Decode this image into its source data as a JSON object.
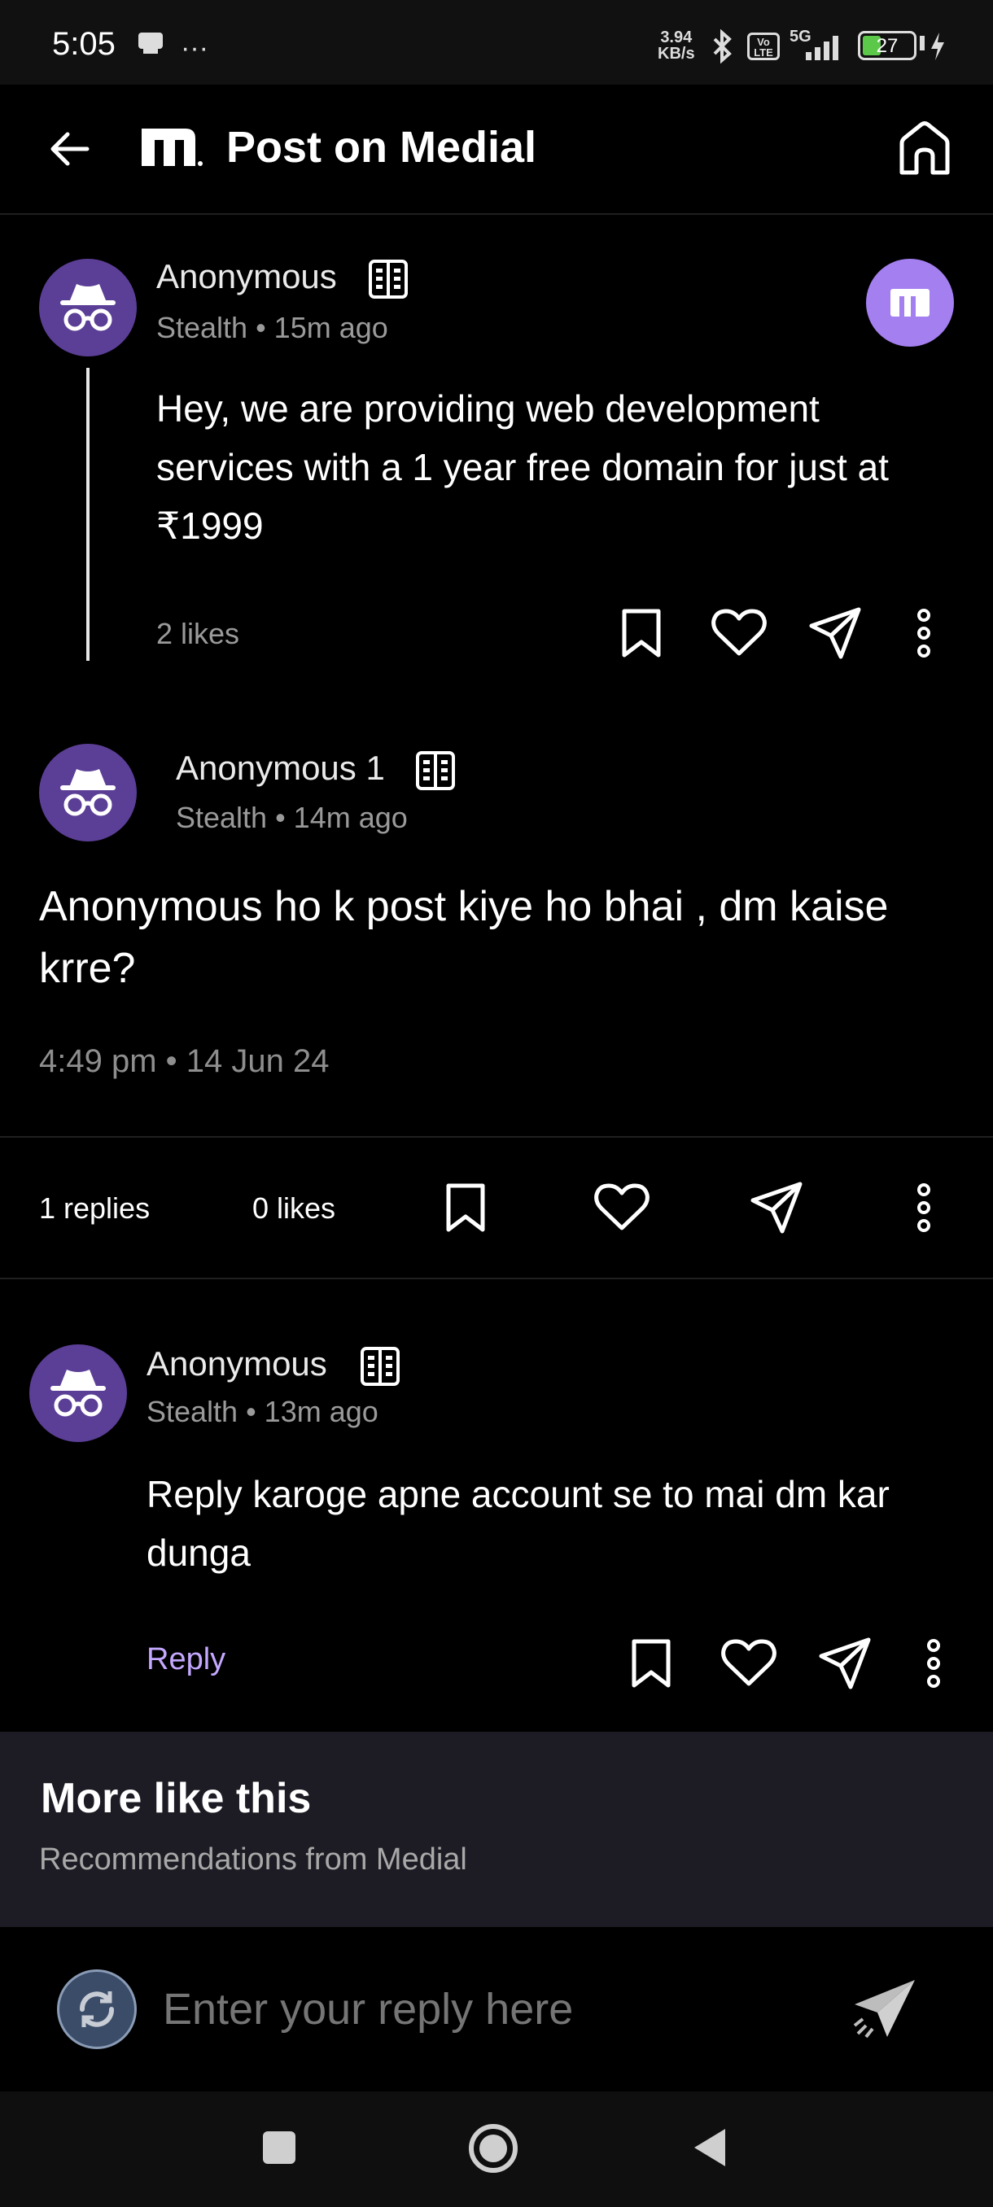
{
  "status_bar": {
    "time": "5:05",
    "net_speed_value": "3.94",
    "net_speed_unit": "KB/s",
    "volte": "Vo LTE",
    "network": "5G",
    "battery": "27"
  },
  "header": {
    "title": "Post on Medial"
  },
  "post": {
    "author": "Anonymous",
    "meta": "Stealth • 15m ago",
    "body": "Hey, we are providing web development services with a 1 year free domain for just at ₹1999",
    "likes": "2 likes"
  },
  "comment": {
    "author": "Anonymous 1",
    "meta": "Stealth • 14m ago",
    "body": "Anonymous ho k post kiye ho bhai , dm kaise krre?",
    "timestamp": "4:49 pm • 14 Jun 24",
    "replies": "1 replies",
    "likes": "0 likes"
  },
  "reply": {
    "author": "Anonymous",
    "meta": "Stealth • 13m ago",
    "body": "Reply karoge apne account se to mai dm kar dunga",
    "reply_label": "Reply"
  },
  "more_like_this": {
    "title": "More like this",
    "subtitle": "Recommendations from Medial"
  },
  "reply_input": {
    "placeholder": "Enter your reply here"
  },
  "colors": {
    "accent": "#a47ff0",
    "avatar": "#5b3e96",
    "reply_link": "#c4a8ff"
  }
}
